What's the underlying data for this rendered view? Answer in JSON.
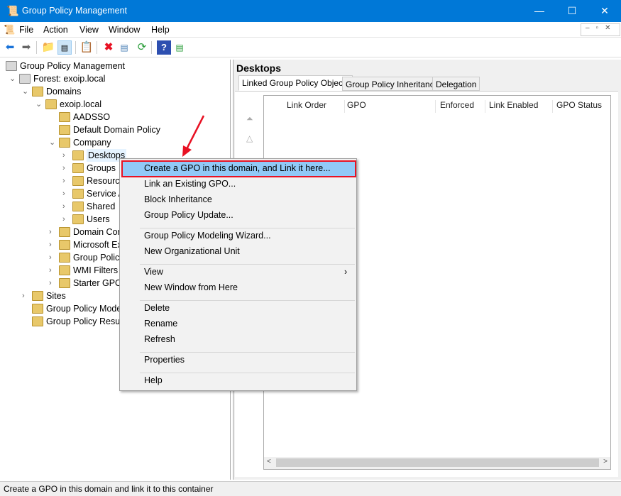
{
  "window": {
    "title": "Group Policy Management",
    "min": "—",
    "max": "☐",
    "close": "✕"
  },
  "menu": [
    "File",
    "Action",
    "View",
    "Window",
    "Help"
  ],
  "tree": [
    {
      "label": "Group Policy Management",
      "level": 0,
      "chev": ""
    },
    {
      "label": "Forest: exoip.local",
      "level": 1,
      "chev": "⌄"
    },
    {
      "label": "Domains",
      "level": 2,
      "chev": "⌄"
    },
    {
      "label": "exoip.local",
      "level": 3,
      "chev": "⌄"
    },
    {
      "label": "AADSSO",
      "level": 4,
      "chev": ""
    },
    {
      "label": "Default Domain Policy",
      "level": 4,
      "chev": ""
    },
    {
      "label": "Company",
      "level": 4,
      "chev": "⌄"
    },
    {
      "label": "Desktops",
      "level": 5,
      "chev": "›"
    },
    {
      "label": "Groups",
      "level": 5,
      "chev": "›"
    },
    {
      "label": "Resource",
      "level": 5,
      "chev": "›"
    },
    {
      "label": "Service A",
      "level": 5,
      "chev": "›"
    },
    {
      "label": "Shared",
      "level": 5,
      "chev": "›"
    },
    {
      "label": "Users",
      "level": 5,
      "chev": "›"
    },
    {
      "label": "Domain Cor",
      "level": 4,
      "chev": "›"
    },
    {
      "label": "Microsoft Ex",
      "level": 4,
      "chev": "›"
    },
    {
      "label": "Group Policy",
      "level": 4,
      "chev": "›"
    },
    {
      "label": "WMI Filters",
      "level": 4,
      "chev": "›"
    },
    {
      "label": "Starter GPOs",
      "level": 4,
      "chev": "›"
    },
    {
      "label": "Sites",
      "level": 2,
      "chev": "›"
    },
    {
      "label": "Group Policy Mode",
      "level": 2,
      "chev": ""
    },
    {
      "label": "Group Policy Result",
      "level": 2,
      "chev": ""
    }
  ],
  "right": {
    "title": "Desktops",
    "tabs": [
      "Linked Group Policy Objects",
      "Group Policy Inheritance",
      "Delegation"
    ],
    "columns": [
      "Link Order",
      "GPO",
      "Enforced",
      "Link Enabled",
      "GPO Status"
    ]
  },
  "context_menu": {
    "items": [
      {
        "label": "Create a GPO in this domain, and Link it here...",
        "sep_before": false
      },
      {
        "label": "Link an Existing GPO...",
        "sep_before": false
      },
      {
        "label": "Block Inheritance",
        "sep_before": false
      },
      {
        "label": "Group Policy Update...",
        "sep_before": false
      },
      {
        "label": "Group Policy Modeling Wizard...",
        "sep_before": true
      },
      {
        "label": "New Organizational Unit",
        "sep_before": false
      },
      {
        "label": "View",
        "sep_before": true,
        "submenu": "›"
      },
      {
        "label": "New Window from Here",
        "sep_before": false
      },
      {
        "label": "Delete",
        "sep_before": true
      },
      {
        "label": "Rename",
        "sep_before": false
      },
      {
        "label": "Refresh",
        "sep_before": false
      },
      {
        "label": "Properties",
        "sep_before": true
      },
      {
        "label": "Help",
        "sep_before": true
      }
    ]
  },
  "status": "Create a GPO in this domain and link it to this container",
  "colors": {
    "accent": "#0078d7",
    "highlight": "#91c9f7",
    "annotation": "#e81123"
  }
}
